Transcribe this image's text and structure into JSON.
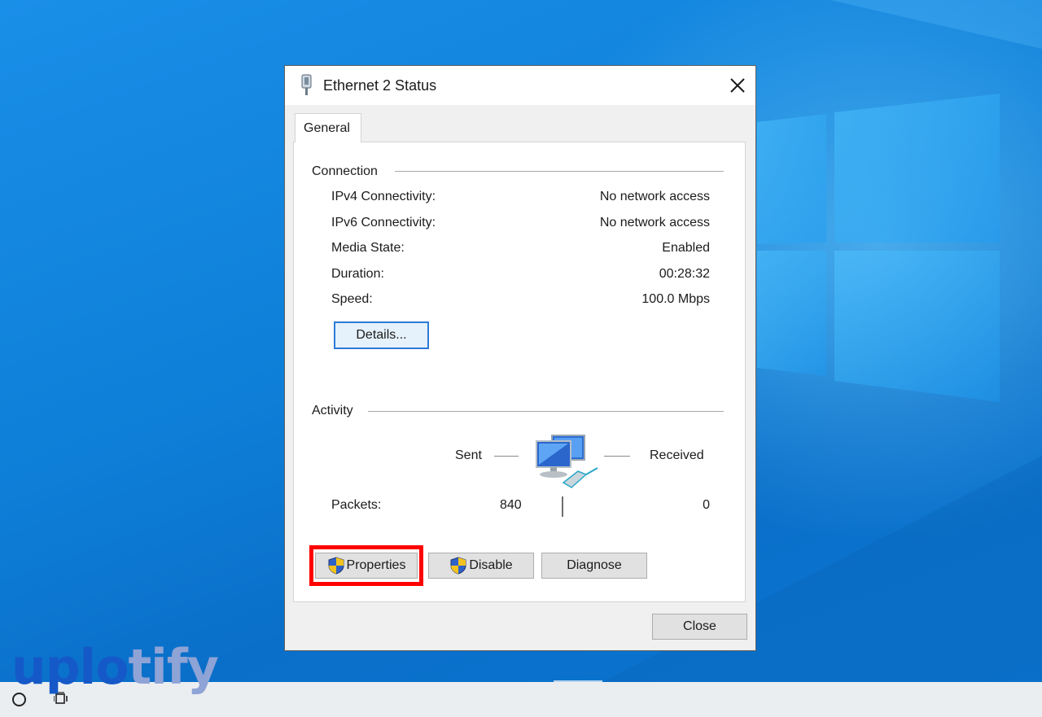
{
  "dialog": {
    "title": "Ethernet 2 Status",
    "tab": "General",
    "connection": {
      "heading": "Connection",
      "rows": [
        {
          "label": "IPv4 Connectivity:",
          "value": "No network access"
        },
        {
          "label": "IPv6 Connectivity:",
          "value": "No network access"
        },
        {
          "label": "Media State:",
          "value": "Enabled"
        },
        {
          "label": "Duration:",
          "value": "00:28:32"
        },
        {
          "label": "Speed:",
          "value": "100.0 Mbps"
        }
      ],
      "details_button": "Details..."
    },
    "activity": {
      "heading": "Activity",
      "sent_label": "Sent",
      "received_label": "Received",
      "packets_label": "Packets:",
      "packets_sent": "840",
      "packets_received": "0"
    },
    "buttons": {
      "properties": "Properties",
      "disable": "Disable",
      "diagnose": "Diagnose",
      "close": "Close"
    }
  },
  "watermark": {
    "part1": "uplo",
    "part2": "tify"
  },
  "colors": {
    "highlight": "#ff0000",
    "accent": "#2c7bd6",
    "brand_dark": "#1559c8",
    "brand_light": "#8ea3d6"
  },
  "icons": [
    "network-adapter-icon",
    "close-icon",
    "uac-shield-icon",
    "network-computers-icon",
    "search-circle-icon",
    "task-view-icon"
  ]
}
